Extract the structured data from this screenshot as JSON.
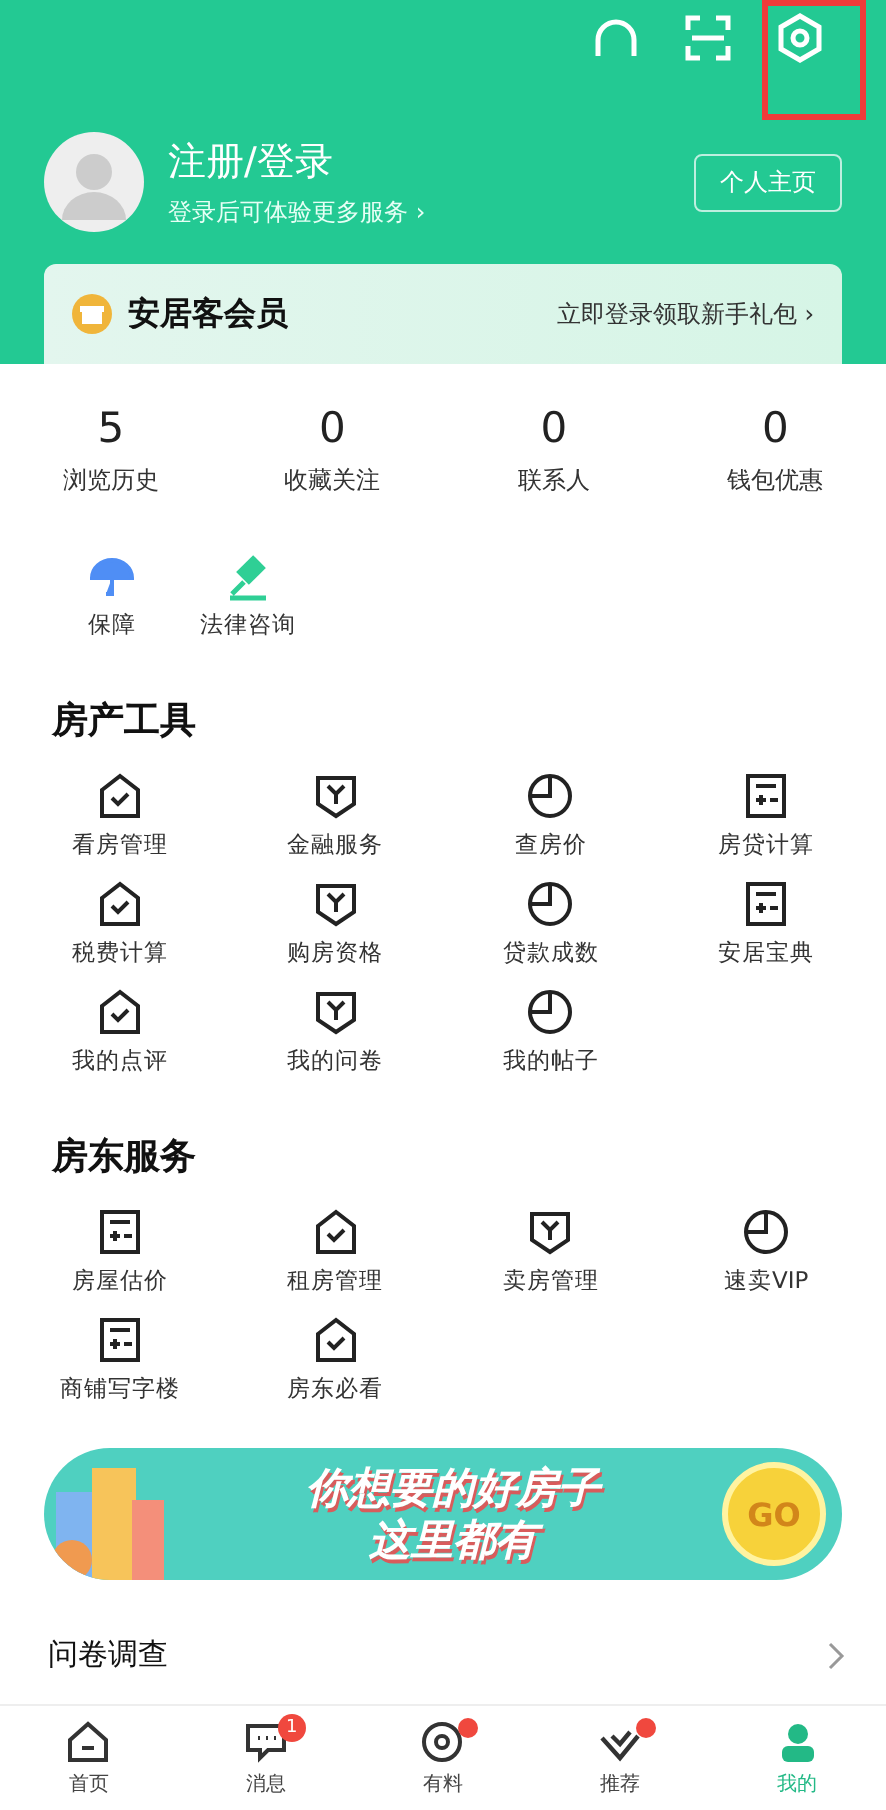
{
  "header": {
    "user_title": "注册/登录",
    "user_subtitle": "登录后可体验更多服务 ›",
    "profile_button": "个人主页"
  },
  "membership": {
    "title": "安居客会员",
    "link": "立即登录领取新手礼包 ›"
  },
  "stats": [
    {
      "value": "5",
      "label": "浏览历史"
    },
    {
      "value": "0",
      "label": "收藏关注"
    },
    {
      "value": "0",
      "label": "联系人"
    },
    {
      "value": "0",
      "label": "钱包优惠"
    }
  ],
  "quick_links": [
    "保障",
    "法律咨询"
  ],
  "sections": [
    {
      "title": "房产工具",
      "items": [
        "看房管理",
        "金融服务",
        "查房价",
        "房贷计算",
        "税费计算",
        "购房资格",
        "贷款成数",
        "安居宝典",
        "我的点评",
        "我的问卷",
        "我的帖子"
      ]
    },
    {
      "title": "房东服务",
      "items": [
        "房屋估价",
        "租房管理",
        "卖房管理",
        "速卖VIP",
        "商铺写字楼",
        "房东必看"
      ]
    }
  ],
  "banner": {
    "line_1": "你想要的好房子",
    "line_2": "这里都有",
    "button": "GO"
  },
  "survey": {
    "title": "问卷调查"
  },
  "tabs": [
    {
      "label": "首页",
      "selected": false,
      "dot": false
    },
    {
      "label": "消息",
      "selected": false,
      "badge": "1",
      "dot": false
    },
    {
      "label": "有料",
      "selected": false,
      "dot": true
    },
    {
      "label": "推荐",
      "selected": false,
      "dot": true
    },
    {
      "label": "我的",
      "selected": true,
      "dot": false
    }
  ]
}
